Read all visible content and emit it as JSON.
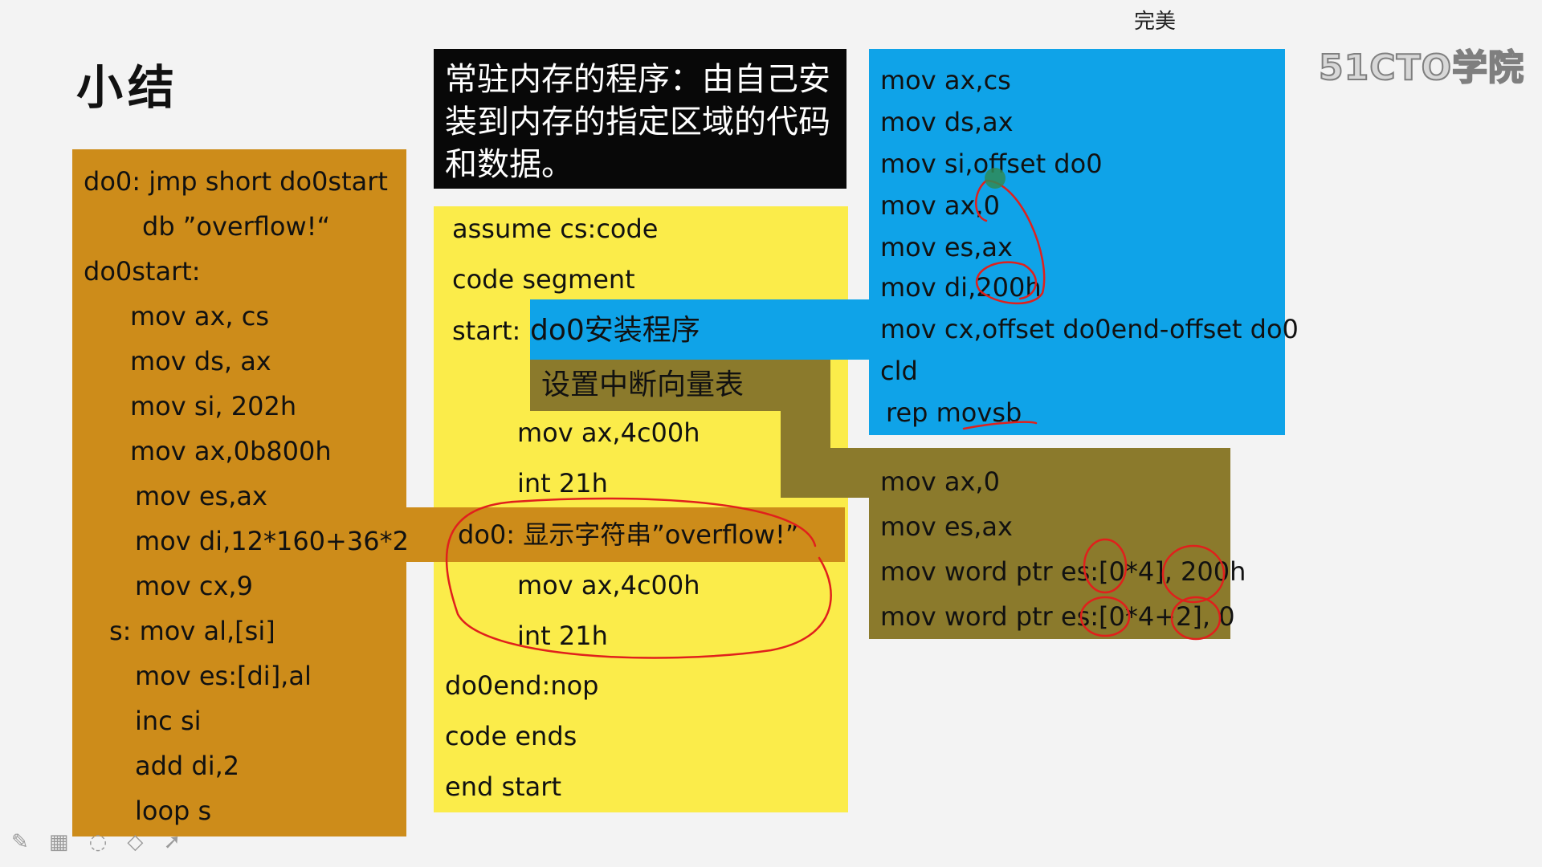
{
  "slide": {
    "title": "小结",
    "top_caption": "完美",
    "watermark": "51CTO学院",
    "definition": "常驻内存的程序：由自己安装到内存的指定区域的代码和数据。",
    "left_code": [
      "do0: jmp short do0start",
      "db ”overflow!“",
      "do0start:",
      "mov ax, cs",
      "mov ds, ax",
      "mov si, 202h",
      "mov ax,0b800h",
      "mov es,ax",
      "mov di,12*160+36*2",
      "mov cx,9",
      "s: mov al,[si]",
      "mov es:[di],al",
      "inc si",
      "add di,2",
      "loop s"
    ],
    "middle_code": {
      "assume": "assume cs:code",
      "segment": "code segment",
      "start": "start:",
      "install": "do0安装程序",
      "vector": "设置中断向量表",
      "mov1": "mov ax,4c00h",
      "int1": "int 21h",
      "do0": "do0: 显示字符串”overflow!”",
      "mov2": "mov ax,4c00h",
      "int2": "int 21h",
      "do0end": "do0end:nop",
      "ends": "code ends",
      "end": "end start"
    },
    "blue_code": [
      "mov ax,cs",
      "mov ds,ax",
      "mov si,offset do0",
      "mov ax,0",
      "mov es,ax",
      "mov di,200h",
      "mov cx,offset do0end-offset do0",
      "cld",
      "rep movsb"
    ],
    "olive_code": [
      "mov ax,0",
      "mov es,ax",
      "mov word ptr es:[0*4], 200h",
      "mov word ptr es:[0*4+2], 0"
    ]
  },
  "toolbar": {
    "icons": [
      "pen-icon",
      "keyboard-icon",
      "lasso-icon",
      "eraser-icon",
      "pointer-icon"
    ]
  },
  "colors": {
    "orange": "#cd8c1a",
    "yellow": "#fbec4a",
    "blue": "#0fa3e8",
    "olive": "#8b7a2c",
    "annotation_red": "#e0201c"
  }
}
